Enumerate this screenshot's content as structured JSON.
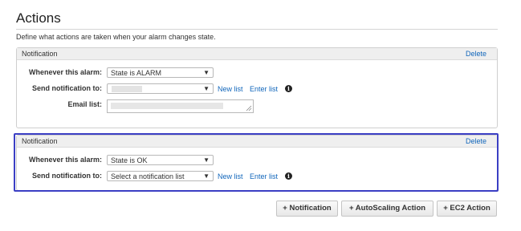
{
  "section": {
    "title": "Actions",
    "description": "Define what actions are taken when your alarm changes state."
  },
  "notifications": [
    {
      "header": "Notification",
      "delete_label": "Delete",
      "alarm_state_label": "Whenever this alarm:",
      "alarm_state_value": "State is ALARM",
      "send_to_label": "Send notification to:",
      "send_to_value": "",
      "new_list_label": "New list",
      "enter_list_label": "Enter list",
      "email_list_label": "Email list:"
    },
    {
      "header": "Notification",
      "delete_label": "Delete",
      "alarm_state_label": "Whenever this alarm:",
      "alarm_state_value": "State is OK",
      "send_to_label": "Send notification to:",
      "send_to_value": "Select a notification list",
      "new_list_label": "New list",
      "enter_list_label": "Enter list"
    }
  ],
  "buttons": {
    "notification": "+ Notification",
    "autoscaling": "+ AutoScaling Action",
    "ec2": "+ EC2 Action"
  },
  "icons": {
    "info": "info-icon",
    "dropdown": "chevron-down-icon",
    "resize": "resize-handle-icon"
  },
  "colors": {
    "link": "#1166bb",
    "highlight": "#3b3fc4"
  }
}
